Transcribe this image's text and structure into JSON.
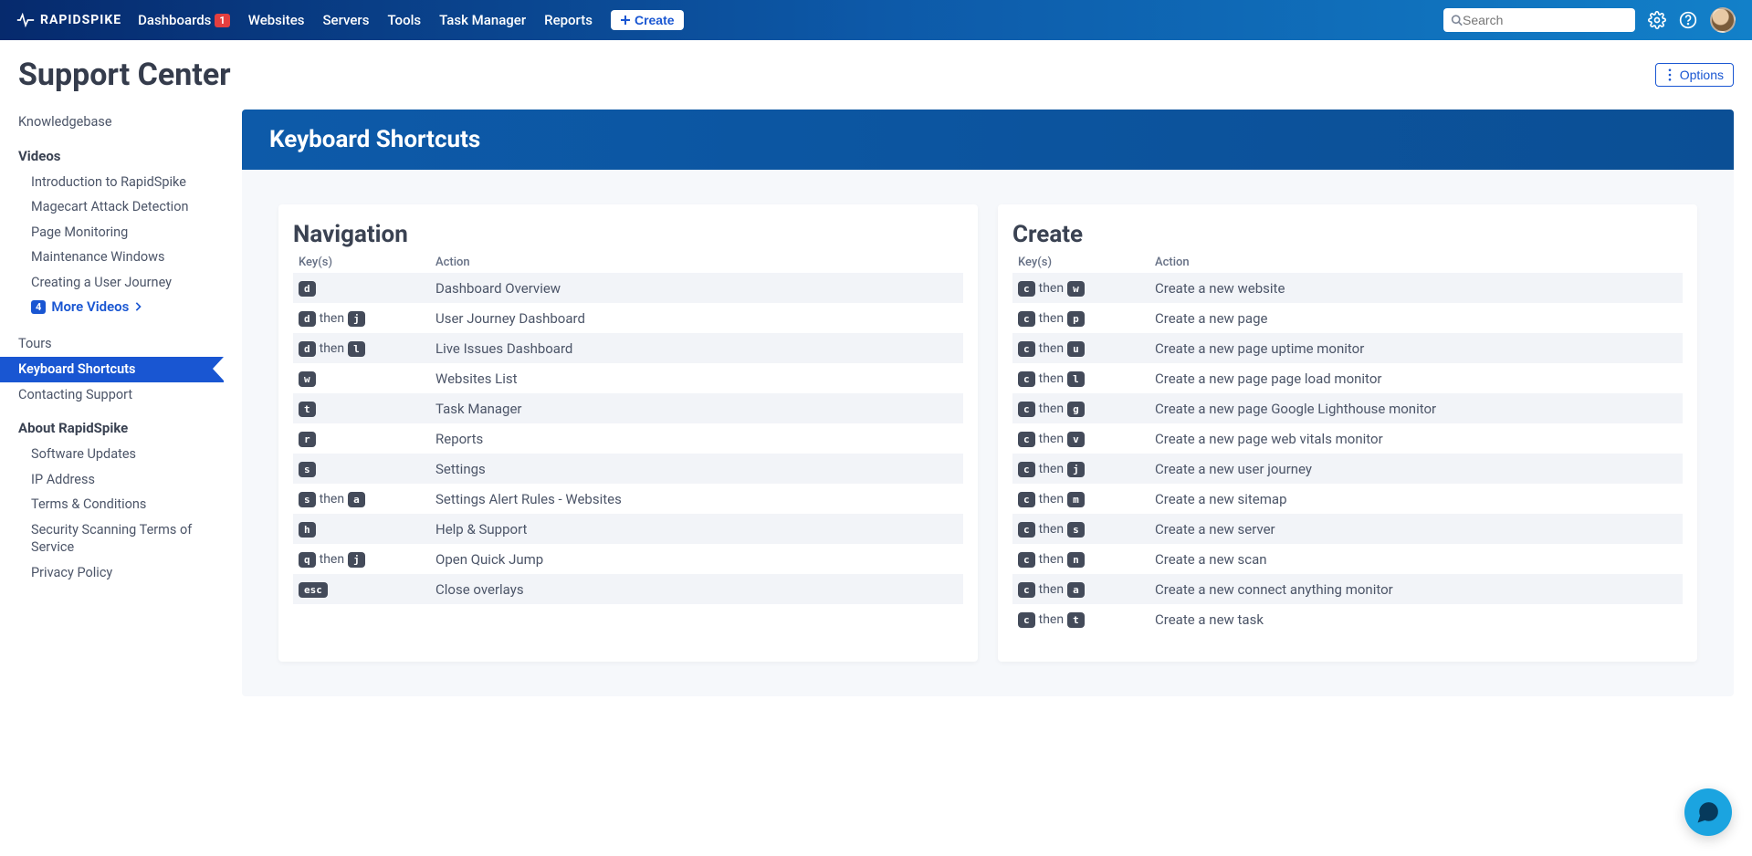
{
  "brand": "RAPIDSPIKE",
  "nav": {
    "dashboards": "Dashboards",
    "dashboards_badge": "1",
    "websites": "Websites",
    "servers": "Servers",
    "tools": "Tools",
    "task_manager": "Task Manager",
    "reports": "Reports",
    "create": "Create"
  },
  "search_placeholder": "Search",
  "page_title": "Support Center",
  "options_label": "Options",
  "sidebar": {
    "knowledgebase": "Knowledgebase",
    "videos_title": "Videos",
    "videos": {
      "intro": "Introduction to RapidSpike",
      "magecart": "Magecart Attack Detection",
      "page_monitoring": "Page Monitoring",
      "maintenance": "Maintenance Windows",
      "creating_journey": "Creating a User Journey"
    },
    "more_videos_badge": "4",
    "more_videos": "More Videos",
    "tours": "Tours",
    "keyboard_shortcuts": "Keyboard Shortcuts",
    "contacting_support": "Contacting Support",
    "about_title": "About RapidSpike",
    "about": {
      "software_updates": "Software Updates",
      "ip_address": "IP Address",
      "terms": "Terms & Conditions",
      "security_terms": "Security Scanning Terms of Service",
      "privacy": "Privacy Policy"
    }
  },
  "banner_title": "Keyboard Shortcuts",
  "headers": {
    "keys": "Key(s)",
    "action": "Action"
  },
  "then_word": "then",
  "navigation": {
    "title": "Navigation",
    "rows": [
      {
        "keys": [
          "d"
        ],
        "action": "Dashboard Overview"
      },
      {
        "keys": [
          "d",
          "j"
        ],
        "action": "User Journey Dashboard"
      },
      {
        "keys": [
          "d",
          "l"
        ],
        "action": "Live Issues Dashboard"
      },
      {
        "keys": [
          "w"
        ],
        "action": "Websites List"
      },
      {
        "keys": [
          "t"
        ],
        "action": "Task Manager"
      },
      {
        "keys": [
          "r"
        ],
        "action": "Reports"
      },
      {
        "keys": [
          "s"
        ],
        "action": "Settings"
      },
      {
        "keys": [
          "s",
          "a"
        ],
        "action": "Settings Alert Rules - Websites"
      },
      {
        "keys": [
          "h"
        ],
        "action": "Help & Support"
      },
      {
        "keys": [
          "q",
          "j"
        ],
        "action": "Open Quick Jump"
      },
      {
        "keys": [
          "esc"
        ],
        "action": "Close overlays"
      }
    ]
  },
  "create": {
    "title": "Create",
    "rows": [
      {
        "keys": [
          "c",
          "w"
        ],
        "action": "Create a new website"
      },
      {
        "keys": [
          "c",
          "p"
        ],
        "action": "Create a new page"
      },
      {
        "keys": [
          "c",
          "u"
        ],
        "action": "Create a new page uptime monitor"
      },
      {
        "keys": [
          "c",
          "l"
        ],
        "action": "Create a new page page load monitor"
      },
      {
        "keys": [
          "c",
          "g"
        ],
        "action": "Create a new page Google Lighthouse monitor"
      },
      {
        "keys": [
          "c",
          "v"
        ],
        "action": "Create a new page web vitals monitor"
      },
      {
        "keys": [
          "c",
          "j"
        ],
        "action": "Create a new user journey"
      },
      {
        "keys": [
          "c",
          "m"
        ],
        "action": "Create a new sitemap"
      },
      {
        "keys": [
          "c",
          "s"
        ],
        "action": "Create a new server"
      },
      {
        "keys": [
          "c",
          "n"
        ],
        "action": "Create a new scan"
      },
      {
        "keys": [
          "c",
          "a"
        ],
        "action": "Create a new connect anything monitor"
      },
      {
        "keys": [
          "c",
          "t"
        ],
        "action": "Create a new task"
      }
    ]
  }
}
